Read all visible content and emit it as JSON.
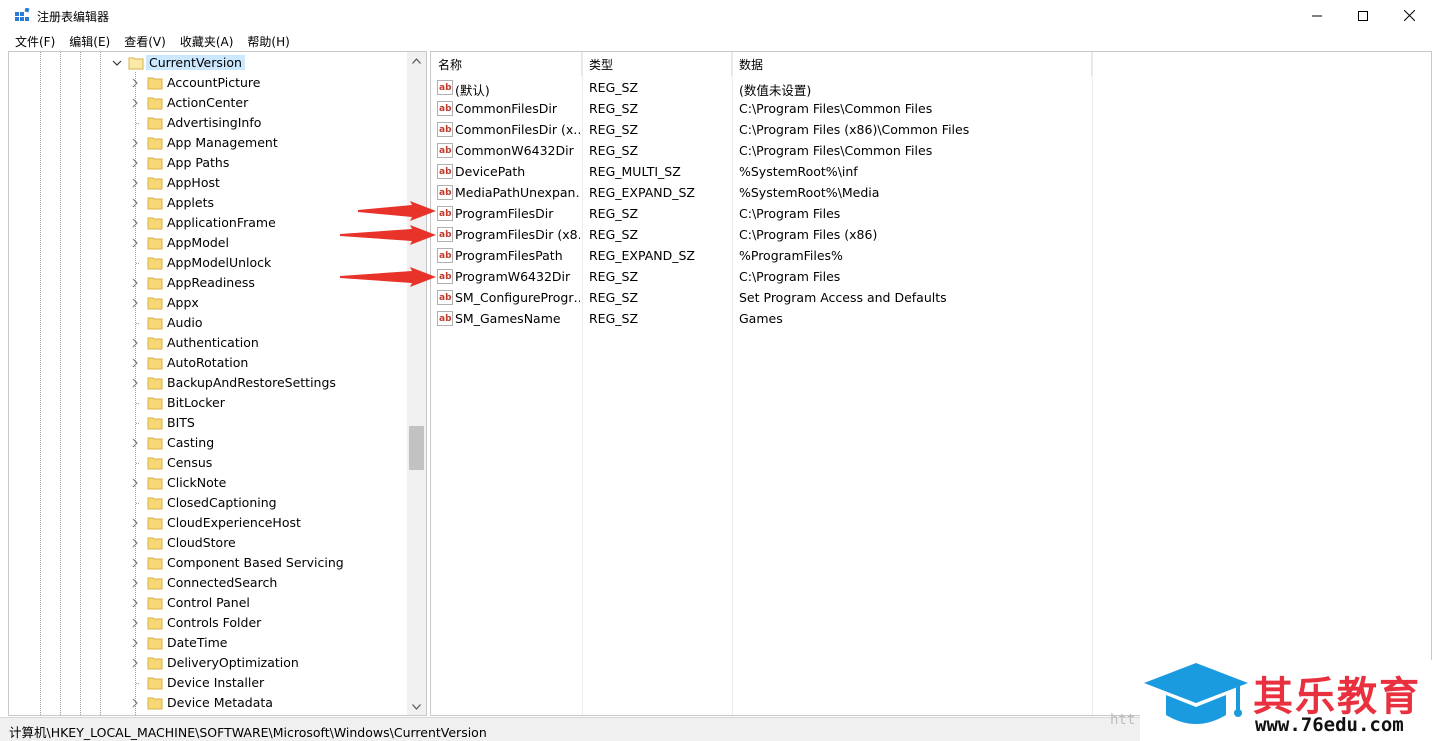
{
  "window": {
    "title": "注册表编辑器"
  },
  "menu": [
    "文件(F)",
    "编辑(E)",
    "查看(V)",
    "收藏夹(A)",
    "帮助(H)"
  ],
  "tree": {
    "selected": "CurrentVersion",
    "items": [
      {
        "label": "AccountPicture",
        "expandable": true
      },
      {
        "label": "ActionCenter",
        "expandable": true
      },
      {
        "label": "AdvertisingInfo",
        "expandable": false
      },
      {
        "label": "App Management",
        "expandable": true
      },
      {
        "label": "App Paths",
        "expandable": true
      },
      {
        "label": "AppHost",
        "expandable": true
      },
      {
        "label": "Applets",
        "expandable": true
      },
      {
        "label": "ApplicationFrame",
        "expandable": true
      },
      {
        "label": "AppModel",
        "expandable": true
      },
      {
        "label": "AppModelUnlock",
        "expandable": false
      },
      {
        "label": "AppReadiness",
        "expandable": true
      },
      {
        "label": "Appx",
        "expandable": true
      },
      {
        "label": "Audio",
        "expandable": false
      },
      {
        "label": "Authentication",
        "expandable": true
      },
      {
        "label": "AutoRotation",
        "expandable": true
      },
      {
        "label": "BackupAndRestoreSettings",
        "expandable": true
      },
      {
        "label": "BitLocker",
        "expandable": false
      },
      {
        "label": "BITS",
        "expandable": false
      },
      {
        "label": "Casting",
        "expandable": true
      },
      {
        "label": "Census",
        "expandable": false
      },
      {
        "label": "ClickNote",
        "expandable": true
      },
      {
        "label": "ClosedCaptioning",
        "expandable": false
      },
      {
        "label": "CloudExperienceHost",
        "expandable": true
      },
      {
        "label": "CloudStore",
        "expandable": true
      },
      {
        "label": "Component Based Servicing",
        "expandable": true
      },
      {
        "label": "ConnectedSearch",
        "expandable": true
      },
      {
        "label": "Control Panel",
        "expandable": true
      },
      {
        "label": "Controls Folder",
        "expandable": true
      },
      {
        "label": "DateTime",
        "expandable": true
      },
      {
        "label": "DeliveryOptimization",
        "expandable": true
      },
      {
        "label": "Device Installer",
        "expandable": false
      },
      {
        "label": "Device Metadata",
        "expandable": true
      }
    ]
  },
  "values": {
    "headers": {
      "name": "名称",
      "type": "类型",
      "data": "数据"
    },
    "rows": [
      {
        "name": "(默认)",
        "type": "REG_SZ",
        "data": "(数值未设置)"
      },
      {
        "name": "CommonFilesDir",
        "type": "REG_SZ",
        "data": "C:\\Program Files\\Common Files"
      },
      {
        "name": "CommonFilesDir (x…",
        "type": "REG_SZ",
        "data": "C:\\Program Files (x86)\\Common Files"
      },
      {
        "name": "CommonW6432Dir",
        "type": "REG_SZ",
        "data": "C:\\Program Files\\Common Files"
      },
      {
        "name": "DevicePath",
        "type": "REG_MULTI_SZ",
        "data": "%SystemRoot%\\inf"
      },
      {
        "name": "MediaPathUnexpan…",
        "type": "REG_EXPAND_SZ",
        "data": "%SystemRoot%\\Media"
      },
      {
        "name": "ProgramFilesDir",
        "type": "REG_SZ",
        "data": "C:\\Program Files"
      },
      {
        "name": "ProgramFilesDir (x8…",
        "type": "REG_SZ",
        "data": "C:\\Program Files (x86)"
      },
      {
        "name": "ProgramFilesPath",
        "type": "REG_EXPAND_SZ",
        "data": "%ProgramFiles%"
      },
      {
        "name": "ProgramW6432Dir",
        "type": "REG_SZ",
        "data": "C:\\Program Files"
      },
      {
        "name": "SM_ConfigureProgr…",
        "type": "REG_SZ",
        "data": "Set Program Access and Defaults"
      },
      {
        "name": "SM_GamesName",
        "type": "REG_SZ",
        "data": "Games"
      }
    ]
  },
  "status": {
    "path": "计算机\\HKEY_LOCAL_MACHINE\\SOFTWARE\\Microsoft\\Windows\\CurrentVersion"
  },
  "watermark": {
    "title": "其乐教育",
    "url": "www.76edu.com",
    "faint": "htt"
  },
  "colors": {
    "arrow": "#e8332a",
    "selection": "#cce8ff",
    "folder": "#f8d775",
    "watermark_red": "#e8303f",
    "watermark_blue": "#1a9be0"
  }
}
